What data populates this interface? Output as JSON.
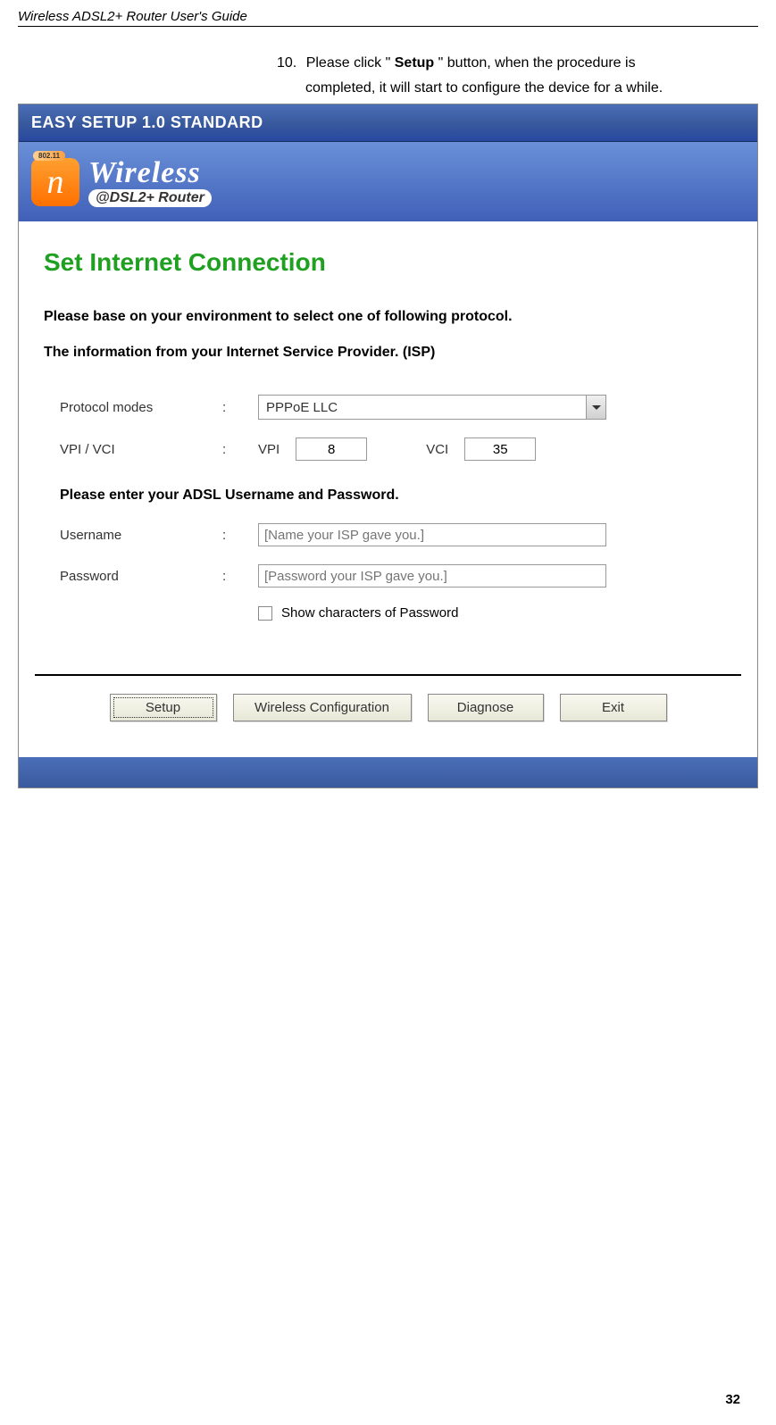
{
  "guide_title": "Wireless ADSL2+ Router User's Guide",
  "instruction": {
    "number": "10.",
    "pre": "Please click \" ",
    "bold": "Setup",
    "post": " \" button, when the procedure is",
    "line2": "completed, it will start to configure the device for a while."
  },
  "window_title": "EASY SETUP 1.0 STANDARD",
  "banner": {
    "badge": "802.11",
    "n": "n",
    "wireless": "Wireless",
    "sub": "@DSL2+ Router"
  },
  "section_title": "Set Internet Connection",
  "desc1": "Please base on your environment to select one of following protocol.",
  "desc2": "The information from your Internet Service Provider. (ISP)",
  "protocol": {
    "label": "Protocol modes",
    "value": "PPPoE LLC"
  },
  "vpivci": {
    "label": "VPI / VCI",
    "vpi_label": "VPI",
    "vpi_value": "8",
    "vci_label": "VCI",
    "vci_value": "35"
  },
  "cred_heading": "Please enter your ADSL Username and Password.",
  "username": {
    "label": "Username",
    "placeholder": "[Name your ISP gave you.]"
  },
  "password": {
    "label": "Password",
    "placeholder": "[Password your ISP gave you.]"
  },
  "show_pw": "Show characters of Password",
  "buttons": {
    "setup": "Setup",
    "wireless": "Wireless Configuration",
    "diagnose": "Diagnose",
    "exit": "Exit"
  },
  "page_num": "32"
}
